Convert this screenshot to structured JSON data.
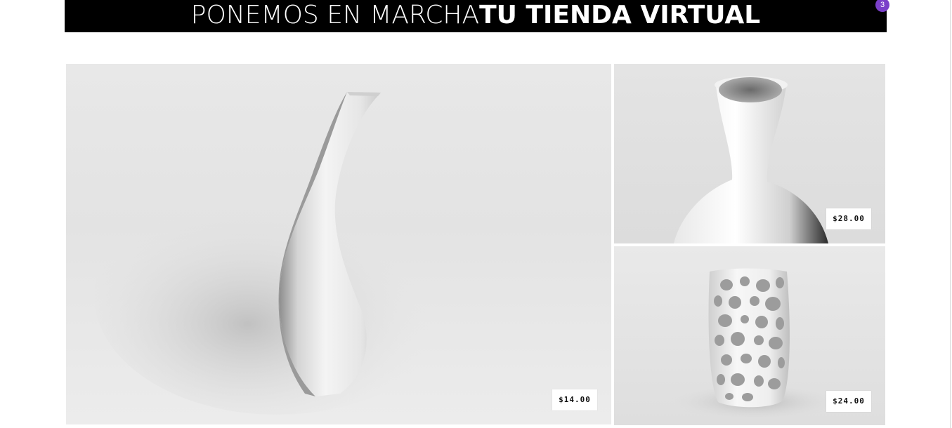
{
  "banner": {
    "text_light": "PONEMOS EN MARCHA",
    "text_bold": "TU TIENDA VIRTUAL",
    "background": "#000000"
  },
  "cart": {
    "count": "3",
    "badge_color": "#7a3fc9"
  },
  "products": [
    {
      "name": "curved-vase",
      "price": "$14.00"
    },
    {
      "name": "carafe-vase",
      "price": "$28.00"
    },
    {
      "name": "perforated-vase",
      "price": "$24.00"
    }
  ]
}
